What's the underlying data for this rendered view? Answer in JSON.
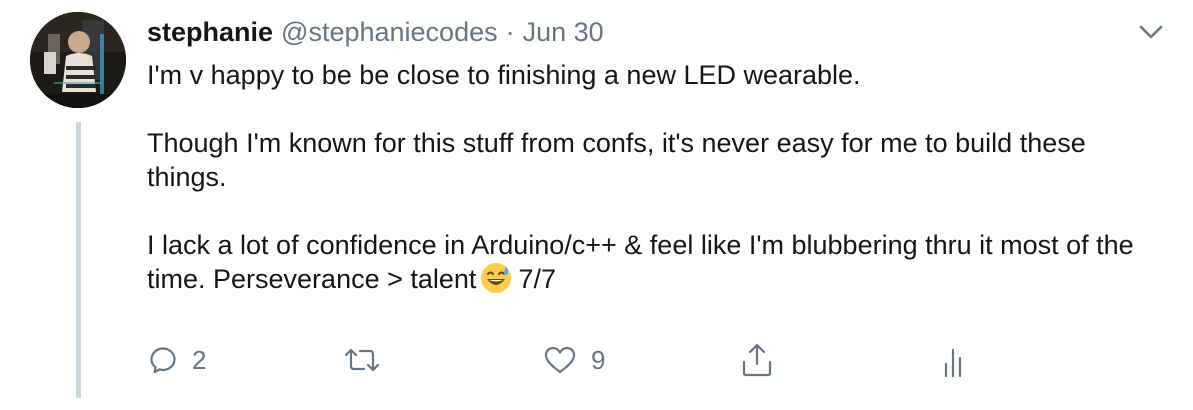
{
  "tweet": {
    "author_name": "stephanie",
    "author_handle": "@stephaniecodes",
    "separator": "·",
    "date": "Jun 30",
    "paragraphs": [
      "I'm v happy to be be close to finishing a new LED wearable.",
      "Though I'm known for this stuff from confs, it's never easy for me to build these things.",
      "I lack a lot of confidence in Arduino/c++ & feel like I'm blubbering thru it most of the time. Perseverance > talent"
    ],
    "emoji": "grinning-face-with-sweat-emoji",
    "thread_position": "7/7"
  },
  "actions": {
    "reply": {
      "icon": "reply-icon",
      "count": "2"
    },
    "retweet": {
      "icon": "retweet-icon",
      "count": ""
    },
    "like": {
      "icon": "heart-icon",
      "count": "9"
    },
    "share": {
      "icon": "share-icon"
    },
    "analytics": {
      "icon": "analytics-icon"
    }
  },
  "colors": {
    "text": "#14171a",
    "muted": "#657786",
    "thread_line": "#ccd6dd"
  }
}
